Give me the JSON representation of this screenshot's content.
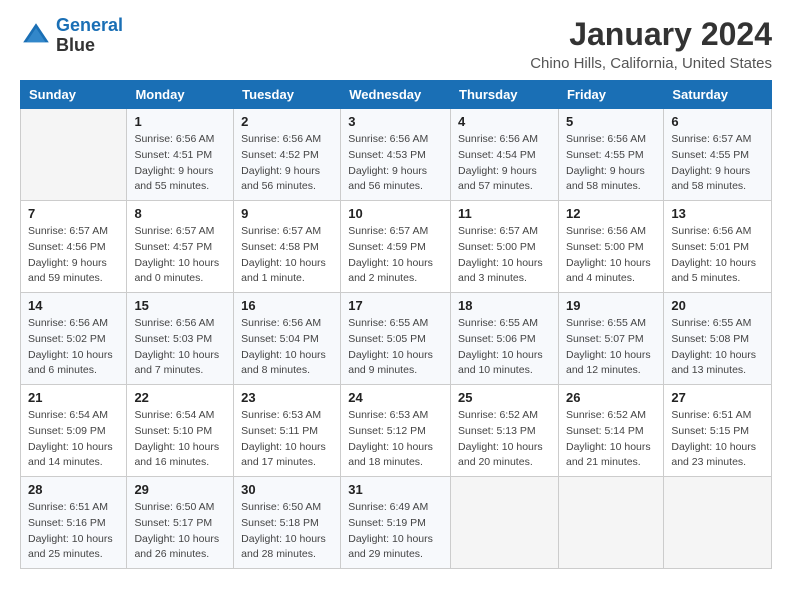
{
  "header": {
    "logo_line1": "General",
    "logo_line2": "Blue",
    "title": "January 2024",
    "subtitle": "Chino Hills, California, United States"
  },
  "calendar": {
    "days_of_week": [
      "Sunday",
      "Monday",
      "Tuesday",
      "Wednesday",
      "Thursday",
      "Friday",
      "Saturday"
    ],
    "weeks": [
      [
        {
          "day": "",
          "sunrise": "",
          "sunset": "",
          "daylight": ""
        },
        {
          "day": "1",
          "sunrise": "Sunrise: 6:56 AM",
          "sunset": "Sunset: 4:51 PM",
          "daylight": "Daylight: 9 hours and 55 minutes."
        },
        {
          "day": "2",
          "sunrise": "Sunrise: 6:56 AM",
          "sunset": "Sunset: 4:52 PM",
          "daylight": "Daylight: 9 hours and 56 minutes."
        },
        {
          "day": "3",
          "sunrise": "Sunrise: 6:56 AM",
          "sunset": "Sunset: 4:53 PM",
          "daylight": "Daylight: 9 hours and 56 minutes."
        },
        {
          "day": "4",
          "sunrise": "Sunrise: 6:56 AM",
          "sunset": "Sunset: 4:54 PM",
          "daylight": "Daylight: 9 hours and 57 minutes."
        },
        {
          "day": "5",
          "sunrise": "Sunrise: 6:56 AM",
          "sunset": "Sunset: 4:55 PM",
          "daylight": "Daylight: 9 hours and 58 minutes."
        },
        {
          "day": "6",
          "sunrise": "Sunrise: 6:57 AM",
          "sunset": "Sunset: 4:55 PM",
          "daylight": "Daylight: 9 hours and 58 minutes."
        }
      ],
      [
        {
          "day": "7",
          "sunrise": "Sunrise: 6:57 AM",
          "sunset": "Sunset: 4:56 PM",
          "daylight": "Daylight: 9 hours and 59 minutes."
        },
        {
          "day": "8",
          "sunrise": "Sunrise: 6:57 AM",
          "sunset": "Sunset: 4:57 PM",
          "daylight": "Daylight: 10 hours and 0 minutes."
        },
        {
          "day": "9",
          "sunrise": "Sunrise: 6:57 AM",
          "sunset": "Sunset: 4:58 PM",
          "daylight": "Daylight: 10 hours and 1 minute."
        },
        {
          "day": "10",
          "sunrise": "Sunrise: 6:57 AM",
          "sunset": "Sunset: 4:59 PM",
          "daylight": "Daylight: 10 hours and 2 minutes."
        },
        {
          "day": "11",
          "sunrise": "Sunrise: 6:57 AM",
          "sunset": "Sunset: 5:00 PM",
          "daylight": "Daylight: 10 hours and 3 minutes."
        },
        {
          "day": "12",
          "sunrise": "Sunrise: 6:56 AM",
          "sunset": "Sunset: 5:00 PM",
          "daylight": "Daylight: 10 hours and 4 minutes."
        },
        {
          "day": "13",
          "sunrise": "Sunrise: 6:56 AM",
          "sunset": "Sunset: 5:01 PM",
          "daylight": "Daylight: 10 hours and 5 minutes."
        }
      ],
      [
        {
          "day": "14",
          "sunrise": "Sunrise: 6:56 AM",
          "sunset": "Sunset: 5:02 PM",
          "daylight": "Daylight: 10 hours and 6 minutes."
        },
        {
          "day": "15",
          "sunrise": "Sunrise: 6:56 AM",
          "sunset": "Sunset: 5:03 PM",
          "daylight": "Daylight: 10 hours and 7 minutes."
        },
        {
          "day": "16",
          "sunrise": "Sunrise: 6:56 AM",
          "sunset": "Sunset: 5:04 PM",
          "daylight": "Daylight: 10 hours and 8 minutes."
        },
        {
          "day": "17",
          "sunrise": "Sunrise: 6:55 AM",
          "sunset": "Sunset: 5:05 PM",
          "daylight": "Daylight: 10 hours and 9 minutes."
        },
        {
          "day": "18",
          "sunrise": "Sunrise: 6:55 AM",
          "sunset": "Sunset: 5:06 PM",
          "daylight": "Daylight: 10 hours and 10 minutes."
        },
        {
          "day": "19",
          "sunrise": "Sunrise: 6:55 AM",
          "sunset": "Sunset: 5:07 PM",
          "daylight": "Daylight: 10 hours and 12 minutes."
        },
        {
          "day": "20",
          "sunrise": "Sunrise: 6:55 AM",
          "sunset": "Sunset: 5:08 PM",
          "daylight": "Daylight: 10 hours and 13 minutes."
        }
      ],
      [
        {
          "day": "21",
          "sunrise": "Sunrise: 6:54 AM",
          "sunset": "Sunset: 5:09 PM",
          "daylight": "Daylight: 10 hours and 14 minutes."
        },
        {
          "day": "22",
          "sunrise": "Sunrise: 6:54 AM",
          "sunset": "Sunset: 5:10 PM",
          "daylight": "Daylight: 10 hours and 16 minutes."
        },
        {
          "day": "23",
          "sunrise": "Sunrise: 6:53 AM",
          "sunset": "Sunset: 5:11 PM",
          "daylight": "Daylight: 10 hours and 17 minutes."
        },
        {
          "day": "24",
          "sunrise": "Sunrise: 6:53 AM",
          "sunset": "Sunset: 5:12 PM",
          "daylight": "Daylight: 10 hours and 18 minutes."
        },
        {
          "day": "25",
          "sunrise": "Sunrise: 6:52 AM",
          "sunset": "Sunset: 5:13 PM",
          "daylight": "Daylight: 10 hours and 20 minutes."
        },
        {
          "day": "26",
          "sunrise": "Sunrise: 6:52 AM",
          "sunset": "Sunset: 5:14 PM",
          "daylight": "Daylight: 10 hours and 21 minutes."
        },
        {
          "day": "27",
          "sunrise": "Sunrise: 6:51 AM",
          "sunset": "Sunset: 5:15 PM",
          "daylight": "Daylight: 10 hours and 23 minutes."
        }
      ],
      [
        {
          "day": "28",
          "sunrise": "Sunrise: 6:51 AM",
          "sunset": "Sunset: 5:16 PM",
          "daylight": "Daylight: 10 hours and 25 minutes."
        },
        {
          "day": "29",
          "sunrise": "Sunrise: 6:50 AM",
          "sunset": "Sunset: 5:17 PM",
          "daylight": "Daylight: 10 hours and 26 minutes."
        },
        {
          "day": "30",
          "sunrise": "Sunrise: 6:50 AM",
          "sunset": "Sunset: 5:18 PM",
          "daylight": "Daylight: 10 hours and 28 minutes."
        },
        {
          "day": "31",
          "sunrise": "Sunrise: 6:49 AM",
          "sunset": "Sunset: 5:19 PM",
          "daylight": "Daylight: 10 hours and 29 minutes."
        },
        {
          "day": "",
          "sunrise": "",
          "sunset": "",
          "daylight": ""
        },
        {
          "day": "",
          "sunrise": "",
          "sunset": "",
          "daylight": ""
        },
        {
          "day": "",
          "sunrise": "",
          "sunset": "",
          "daylight": ""
        }
      ]
    ]
  }
}
